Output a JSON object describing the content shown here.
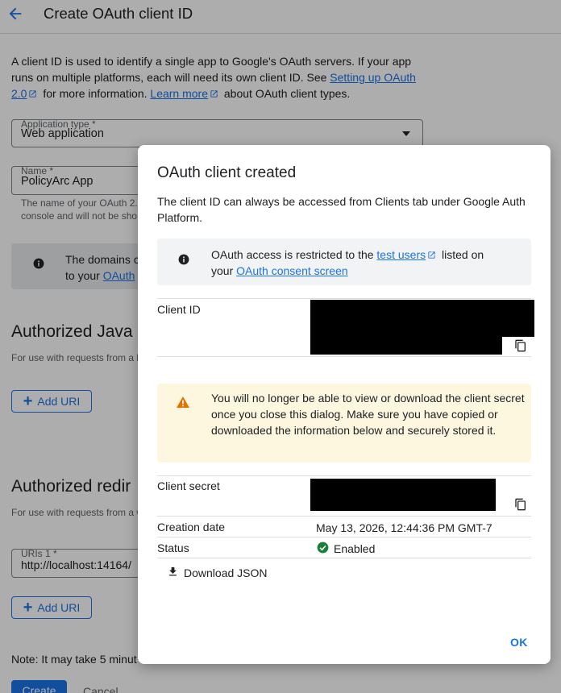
{
  "header": {
    "title": "Create OAuth client ID"
  },
  "intro": {
    "text_1": "A client ID is used to identify a single app to Google's OAuth servers. If your app runs on multiple platforms, each will need its own client ID. See ",
    "link_setup": "Setting up OAuth 2.0",
    "text_2": " for more information. ",
    "link_learn_more": "Learn more",
    "text_3": " about OAuth client types."
  },
  "form": {
    "app_type": {
      "label": "Application type *",
      "value": "Web application"
    },
    "name": {
      "label": "Name *",
      "value": "PolicyArc App"
    },
    "name_helper_1": "The name of your OAuth 2.0",
    "name_helper_2": "console and will not be sho",
    "domains_info_1": "The domains c",
    "domains_info_2": "to your ",
    "domains_info_link": "OAuth",
    "js_origins": {
      "title": "Authorized Java",
      "subtitle": "For use with requests from a b",
      "add_label": "Add URI"
    },
    "redirects": {
      "title": "Authorized redir",
      "subtitle": "For use with requests from a w",
      "uri_label": "URIs 1 *",
      "uri_value": "http://localhost:14164/",
      "add_label": "Add URI"
    },
    "note": "Note: It may take 5 minut",
    "create_label": "Create",
    "cancel_label": "Cancel"
  },
  "dialog": {
    "title": "OAuth client created",
    "description": "The client ID can always be accessed from Clients tab under Google Auth Platform.",
    "info": {
      "text_1": "OAuth access is restricted to the ",
      "link_test_users": "test users",
      "text_2": " listed on",
      "text_3": "your ",
      "link_consent": "OAuth consent screen"
    },
    "client_id_label": "Client ID",
    "warning": "You will no longer be able to view or download the client secret once you close this dialog. Make sure you have copied or downloaded the information below and securely stored it.",
    "client_secret_label": "Client secret",
    "creation_date_label": "Creation date",
    "creation_date_value": "May 13, 2026, 12:44:36 PM GMT-7",
    "status_label": "Status",
    "status_value": "Enabled",
    "download_label": "Download JSON",
    "ok_label": "OK"
  },
  "colors": {
    "accent": "#1a73e8",
    "success": "#188038",
    "warning": "#e37400",
    "warning_bg": "#fef7e0",
    "info_bg": "#f1f3f4"
  }
}
